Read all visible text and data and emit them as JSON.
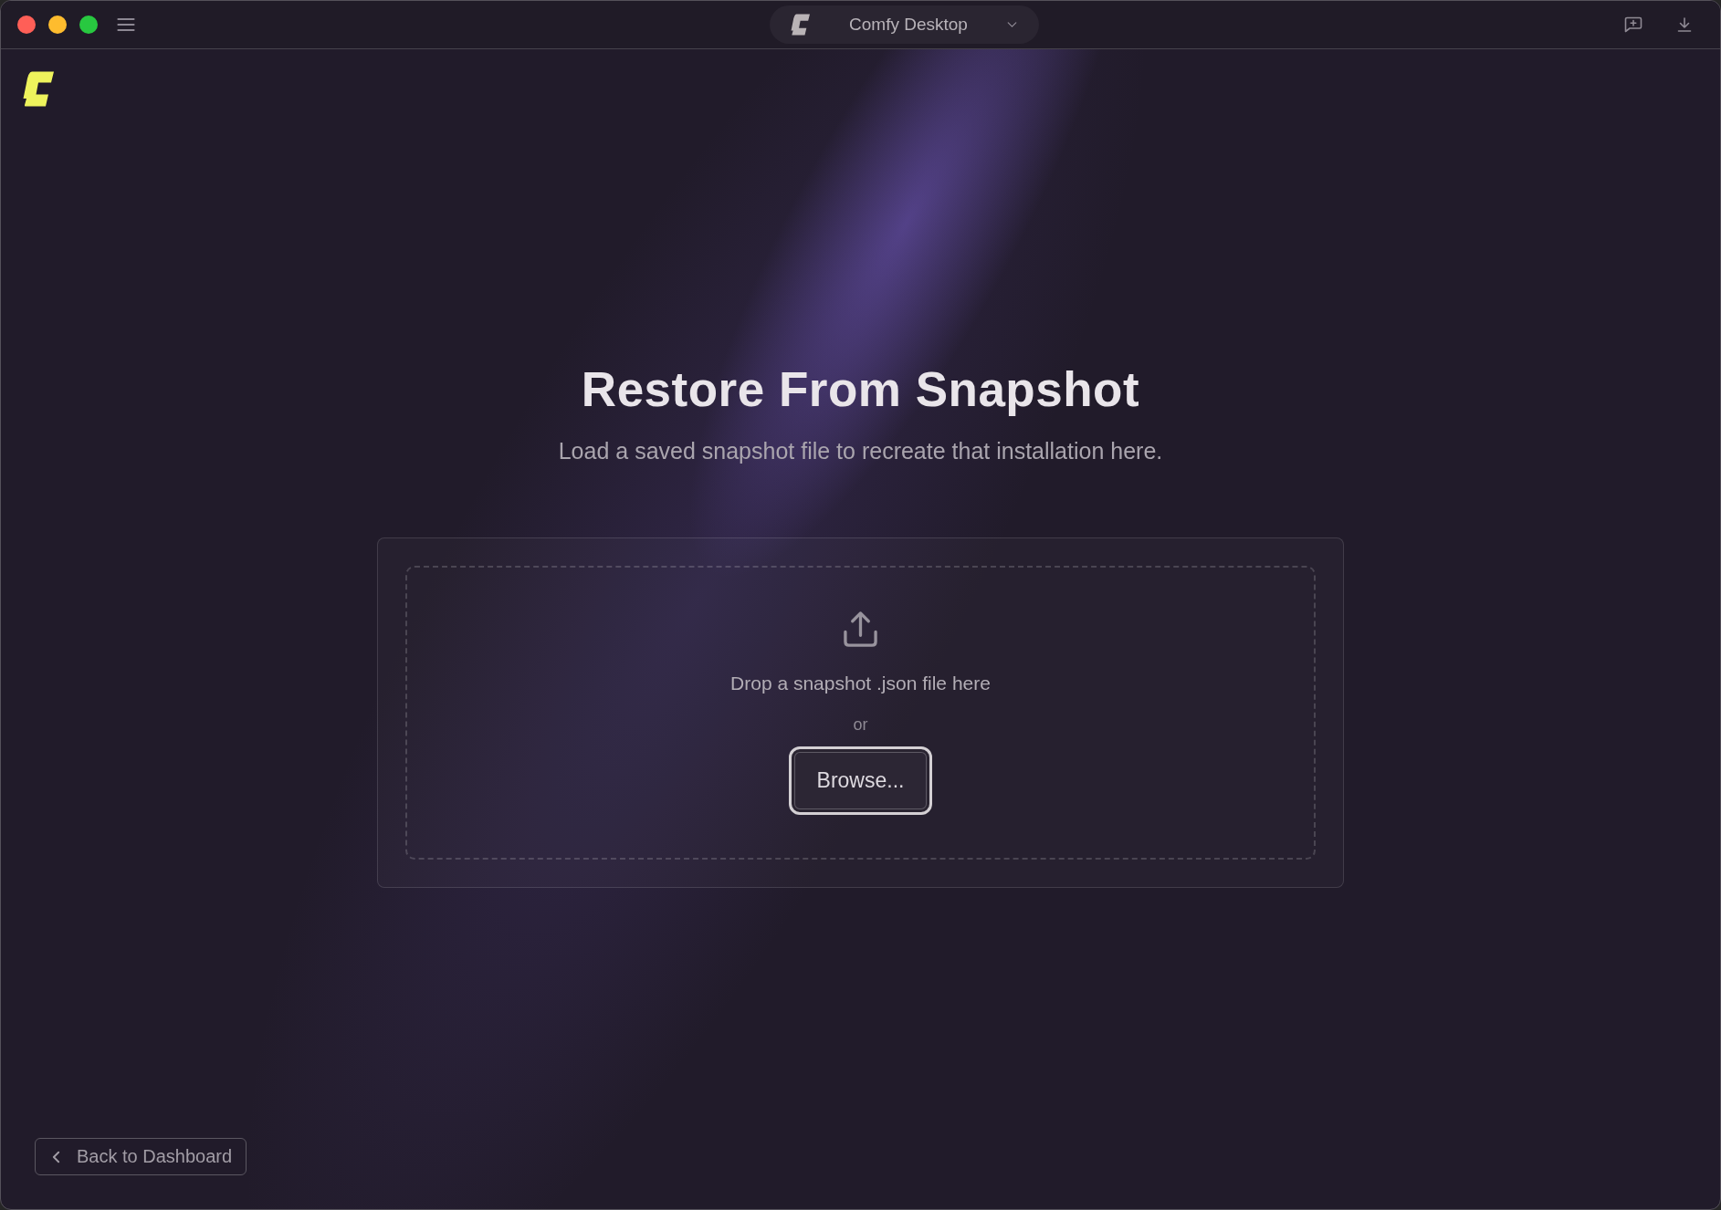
{
  "title_bar": {
    "selector": "Comfy Desktop"
  },
  "heading": "Restore From Snapshot",
  "subtitle": "Load a saved snapshot file to recreate that installation here.",
  "drop_zone": {
    "prompt": "Drop a snapshot .json file here",
    "separator": "or",
    "browse_button": {
      "label": "Browse...",
      "focused": true
    }
  },
  "back_button": "Back to Dashboard"
}
